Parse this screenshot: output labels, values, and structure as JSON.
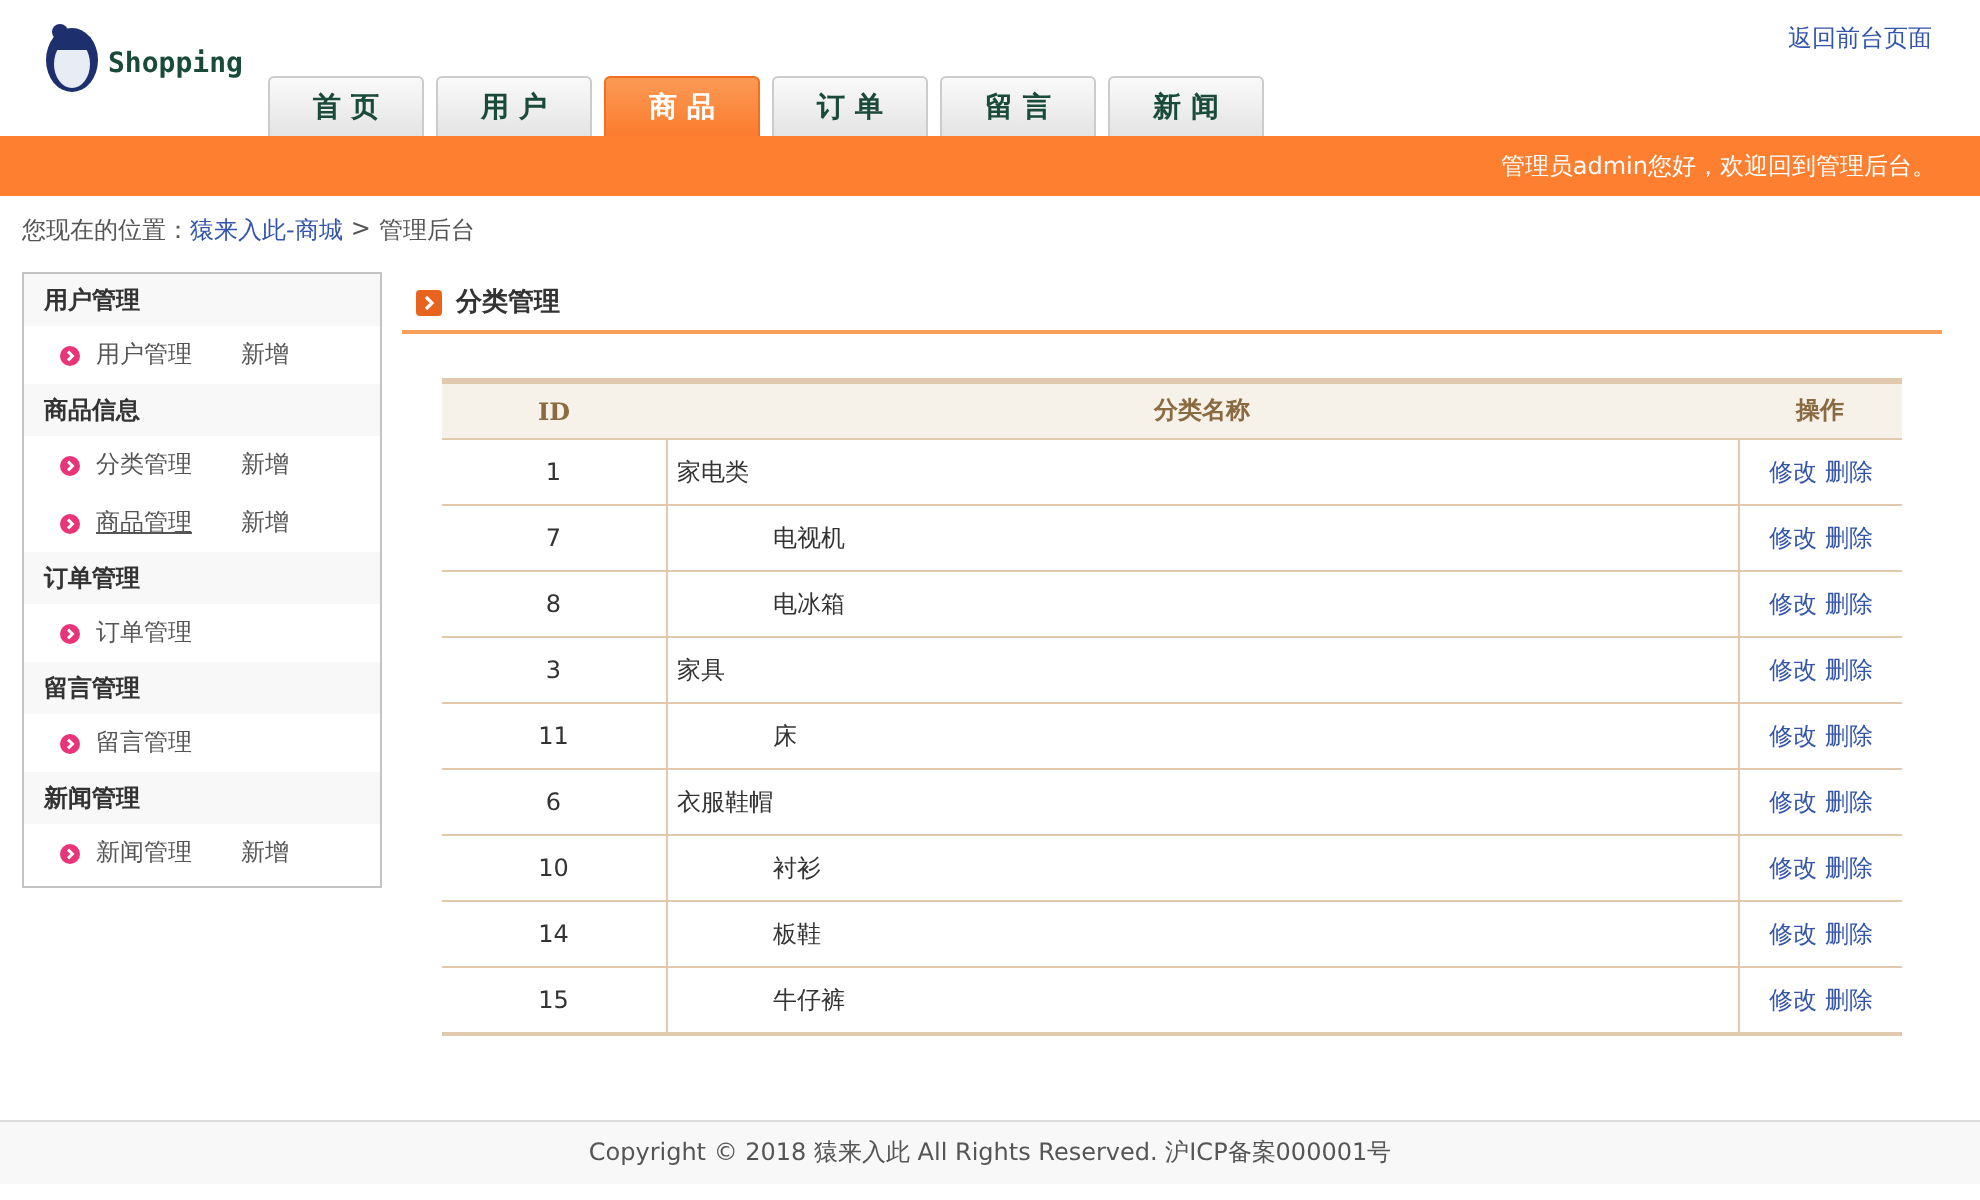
{
  "logo": {
    "text": "Shopping"
  },
  "top_link": "返回前台页面",
  "nav_tabs": [
    {
      "label": "首页",
      "selected": false
    },
    {
      "label": "用户",
      "selected": false
    },
    {
      "label": "商品",
      "selected": true
    },
    {
      "label": "订单",
      "selected": false
    },
    {
      "label": "留言",
      "selected": false
    },
    {
      "label": "新闻",
      "selected": false
    }
  ],
  "welcome": "管理员admin您好，欢迎回到管理后台。",
  "breadcrumb": {
    "label": "您现在的位置：",
    "link": "猿来入此-商城",
    "separator": ">",
    "current": "管理后台"
  },
  "sidebar": {
    "groups": [
      {
        "title": "用户管理",
        "items": [
          {
            "label": "用户管理",
            "action": "新增",
            "hovered": false
          }
        ]
      },
      {
        "title": "商品信息",
        "items": [
          {
            "label": "分类管理",
            "action": "新增",
            "hovered": false
          },
          {
            "label": "商品管理",
            "action": "新增",
            "hovered": true
          }
        ]
      },
      {
        "title": "订单管理",
        "items": [
          {
            "label": "订单管理",
            "hovered": false
          }
        ]
      },
      {
        "title": "留言管理",
        "items": [
          {
            "label": "留言管理",
            "hovered": false
          }
        ]
      },
      {
        "title": "新闻管理",
        "items": [
          {
            "label": "新闻管理",
            "action": "新增",
            "hovered": false
          }
        ]
      }
    ]
  },
  "panel": {
    "title": "分类管理"
  },
  "table": {
    "columns": [
      "ID",
      "分类名称",
      "操作"
    ],
    "rows": [
      {
        "id": "1",
        "name": "家电类",
        "actions": [
          "修改",
          "删除"
        ],
        "children": [
          {
            "id": "7",
            "name": "电视机",
            "actions": [
              "修改",
              "删除"
            ]
          },
          {
            "id": "8",
            "name": "电冰箱",
            "actions": [
              "修改",
              "删除"
            ]
          }
        ]
      },
      {
        "id": "3",
        "name": "家具",
        "actions": [
          "修改",
          "删除"
        ],
        "children": [
          {
            "id": "11",
            "name": "床",
            "actions": [
              "修改",
              "删除"
            ]
          }
        ]
      },
      {
        "id": "6",
        "name": "衣服鞋帽",
        "actions": [
          "修改",
          "删除"
        ],
        "children": [
          {
            "id": "10",
            "name": "衬衫",
            "actions": [
              "修改",
              "删除"
            ]
          },
          {
            "id": "14",
            "name": "板鞋",
            "actions": [
              "修改",
              "删除"
            ]
          },
          {
            "id": "15",
            "name": "牛仔裤",
            "actions": [
              "修改",
              "删除"
            ]
          }
        ]
      }
    ]
  },
  "footer": "Copyright © 2018 猿来入此 All Rights Reserved. 沪ICP备案000001号"
}
